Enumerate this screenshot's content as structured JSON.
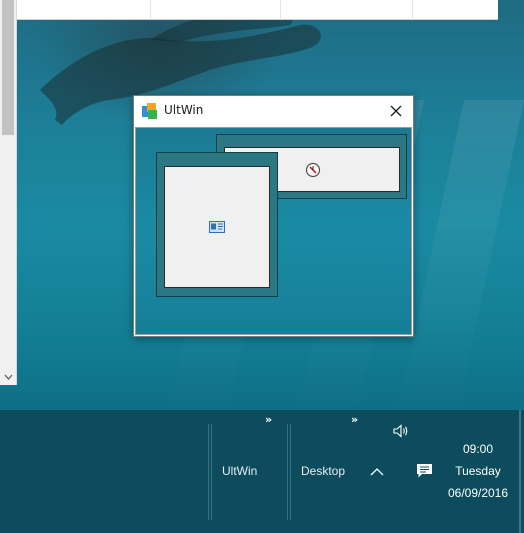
{
  "window": {
    "title": "UltWin"
  },
  "taskbar": {
    "buttons": [
      {
        "label": "UltWin"
      },
      {
        "label": "Desktop"
      }
    ],
    "overflow_glyph": "»",
    "clock": {
      "time": "09:00",
      "day": "Tuesday",
      "date": "06/09/2016"
    }
  },
  "colors": {
    "taskbar": "#0c4c5c",
    "panel_frame": "#2c7784",
    "panel_face": "#f0f0f0"
  }
}
